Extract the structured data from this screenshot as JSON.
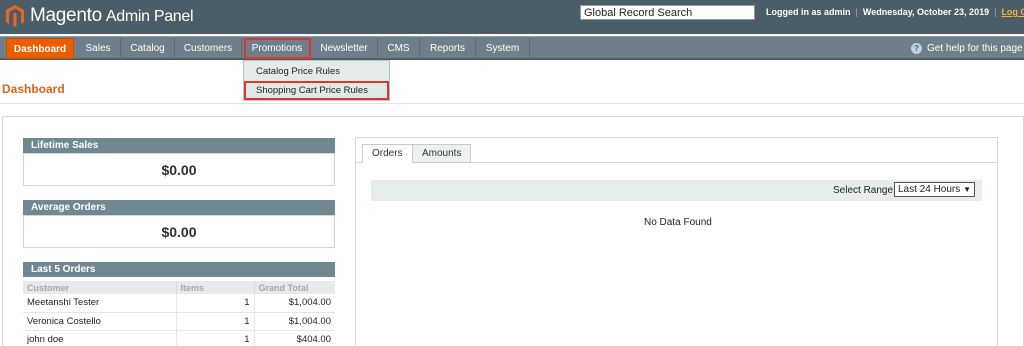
{
  "header": {
    "logo_main": "Magento",
    "logo_sub": "Admin Panel",
    "search_value": "Global Record Search",
    "logged_in": "Logged in as admin",
    "date": "Wednesday, October 23, 2019",
    "logout": "Log Out"
  },
  "nav": {
    "items": [
      "Dashboard",
      "Sales",
      "Catalog",
      "Customers",
      "Promotions",
      "Newsletter",
      "CMS",
      "Reports",
      "System"
    ],
    "help": "Get help for this page"
  },
  "dropdown": {
    "items": [
      "Catalog Price Rules",
      "Shopping Cart Price Rules"
    ]
  },
  "page": {
    "title": "Dashboard"
  },
  "stats": {
    "lifetime_sales_label": "Lifetime Sales",
    "lifetime_sales_value": "$0.00",
    "average_orders_label": "Average Orders",
    "average_orders_value": "$0.00"
  },
  "last_orders": {
    "title": "Last 5 Orders",
    "columns": [
      "Customer",
      "Items",
      "Grand Total"
    ],
    "rows": [
      {
        "customer": "Meetanshi Tester",
        "items": "1",
        "total": "$1,004.00"
      },
      {
        "customer": "Veronica Costello",
        "items": "1",
        "total": "$1,004.00"
      },
      {
        "customer": "john doe",
        "items": "1",
        "total": "$404.00"
      }
    ]
  },
  "chart_panel": {
    "tabs": [
      "Orders",
      "Amounts"
    ],
    "range_label": "Select Range:",
    "range_value": "Last 24 Hours",
    "no_data": "No Data Found"
  },
  "colors": {
    "header_bg": "#4a5e6a",
    "nav_bg": "#6e7f89",
    "active_tab": "#eb5e00",
    "highlight": "#e0342f",
    "title": "#e0611a"
  }
}
